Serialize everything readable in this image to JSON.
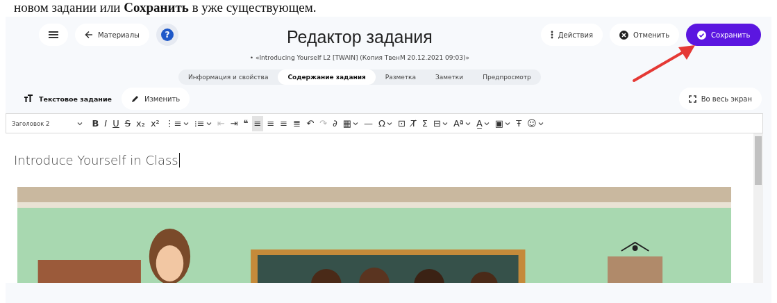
{
  "document_text": "новом задании или **Сохранить** в уже существующем.",
  "header": {
    "menu_label": "Материалы",
    "help": "?",
    "title": "Редактор задания",
    "subtitle": "• «Introducing Yourself L2 [TWAIN] (Копия ТвенМ 20.12.2021 09:03)»",
    "actions": [
      {
        "kind": "menu",
        "label": "Действия"
      },
      {
        "kind": "cancel",
        "label": "Отменить"
      },
      {
        "kind": "save",
        "label": "Сохранить"
      }
    ]
  },
  "tabs": [
    {
      "label": "Информация и свойства",
      "selected": false
    },
    {
      "label": "Содержание задания",
      "selected": true
    },
    {
      "label": "Разметка",
      "selected": false
    },
    {
      "label": "Заметки",
      "selected": false
    },
    {
      "label": "Предпросмотр",
      "selected": false
    }
  ],
  "task_bar": {
    "type_label": "Текстовое задание",
    "edit_label": "Изменить",
    "fullscreen_label": "Во весь экран"
  },
  "toolbar": {
    "heading": "Заголовок 2",
    "tools": [
      {
        "glyph": "B",
        "dropdown": false,
        "pressed": false,
        "disabled": false
      },
      {
        "glyph": "I",
        "dropdown": false,
        "pressed": false,
        "disabled": false
      },
      {
        "glyph": "U",
        "dropdown": false,
        "pressed": false,
        "disabled": false
      },
      {
        "glyph": "S",
        "dropdown": false,
        "pressed": false,
        "disabled": false
      },
      {
        "glyph": "x₂",
        "dropdown": false,
        "pressed": false,
        "disabled": false
      },
      {
        "glyph": "x²",
        "dropdown": false,
        "pressed": false,
        "disabled": false
      },
      {
        "glyph": "⋮≡",
        "dropdown": true,
        "pressed": false,
        "disabled": false
      },
      {
        "glyph": "⁝≡",
        "dropdown": true,
        "pressed": false,
        "disabled": false
      },
      {
        "glyph": "⇤",
        "dropdown": false,
        "pressed": false,
        "disabled": true
      },
      {
        "glyph": "⇥",
        "dropdown": false,
        "pressed": false,
        "disabled": false
      },
      {
        "glyph": "❝",
        "dropdown": false,
        "pressed": false,
        "disabled": false
      },
      {
        "glyph": "≡",
        "dropdown": false,
        "pressed": true,
        "disabled": false
      },
      {
        "glyph": "≡",
        "dropdown": false,
        "pressed": false,
        "disabled": false
      },
      {
        "glyph": "≡",
        "dropdown": false,
        "pressed": false,
        "disabled": false
      },
      {
        "glyph": "≣",
        "dropdown": false,
        "pressed": false,
        "disabled": false
      },
      {
        "glyph": "↶",
        "dropdown": false,
        "pressed": false,
        "disabled": false
      },
      {
        "glyph": "↷",
        "dropdown": false,
        "pressed": false,
        "disabled": true
      },
      {
        "glyph": "∂",
        "dropdown": false,
        "pressed": false,
        "disabled": false
      },
      {
        "glyph": "▦",
        "dropdown": true,
        "pressed": false,
        "disabled": false
      },
      {
        "glyph": "—",
        "dropdown": false,
        "pressed": false,
        "disabled": false
      },
      {
        "glyph": "Ω",
        "dropdown": true,
        "pressed": false,
        "disabled": false
      },
      {
        "glyph": "⊡",
        "dropdown": false,
        "pressed": false,
        "disabled": false
      },
      {
        "glyph": "T̸",
        "dropdown": false,
        "pressed": false,
        "disabled": false
      },
      {
        "glyph": "Σ",
        "dropdown": false,
        "pressed": false,
        "disabled": false
      },
      {
        "glyph": "⊟",
        "dropdown": true,
        "pressed": false,
        "disabled": false
      },
      {
        "glyph": "Aª",
        "dropdown": true,
        "pressed": false,
        "disabled": false
      },
      {
        "glyph": "A̲",
        "dropdown": true,
        "pressed": false,
        "disabled": false
      },
      {
        "glyph": "▣",
        "dropdown": true,
        "pressed": false,
        "disabled": false
      },
      {
        "glyph": "Ŧ",
        "dropdown": false,
        "pressed": false,
        "disabled": false
      },
      {
        "glyph": "☺",
        "dropdown": true,
        "pressed": false,
        "disabled": false
      }
    ]
  },
  "editor": {
    "heading": "Introduce Yourself in Class"
  }
}
